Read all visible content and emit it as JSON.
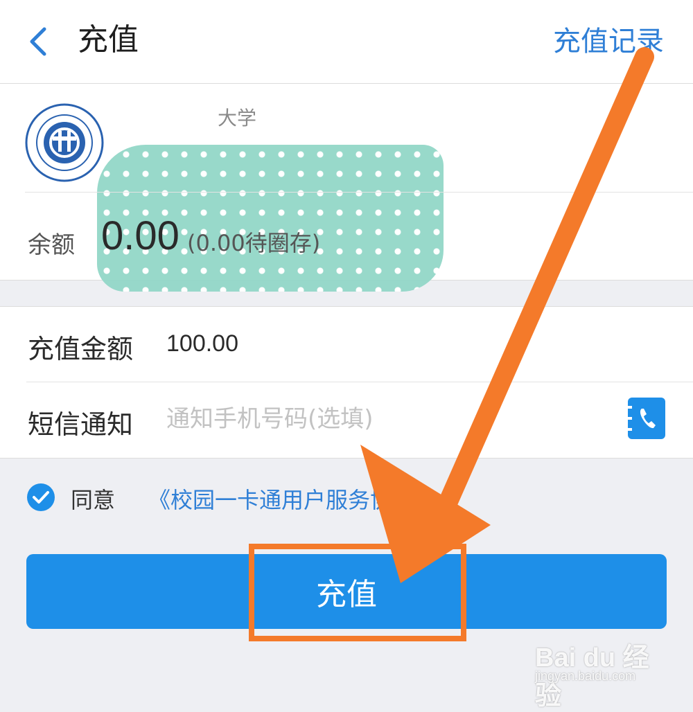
{
  "header": {
    "title": "充值",
    "record_link": "充值记录",
    "back_icon": "chevron-left-icon"
  },
  "card": {
    "school_name_visible": "大学",
    "balance_label": "余额",
    "balance_value": "0.00",
    "balance_pending": "(0.00待圈存)"
  },
  "form": {
    "amount_label": "充值金额",
    "amount_value": "100.00",
    "sms_label": "短信通知",
    "sms_placeholder": "通知手机号码(选填)",
    "phone_icon": "phone-book-icon"
  },
  "agreement": {
    "checked": true,
    "prefix": "同意",
    "link": "《校园一卡通用户服务协议》"
  },
  "submit_label": "充值",
  "watermark": {
    "brand": "Bai du 经验",
    "url": "jingyan.baidu.com"
  },
  "colors": {
    "accent": "#1e8fe8",
    "link": "#2f7fd6",
    "annotation": "#f47a2a"
  }
}
